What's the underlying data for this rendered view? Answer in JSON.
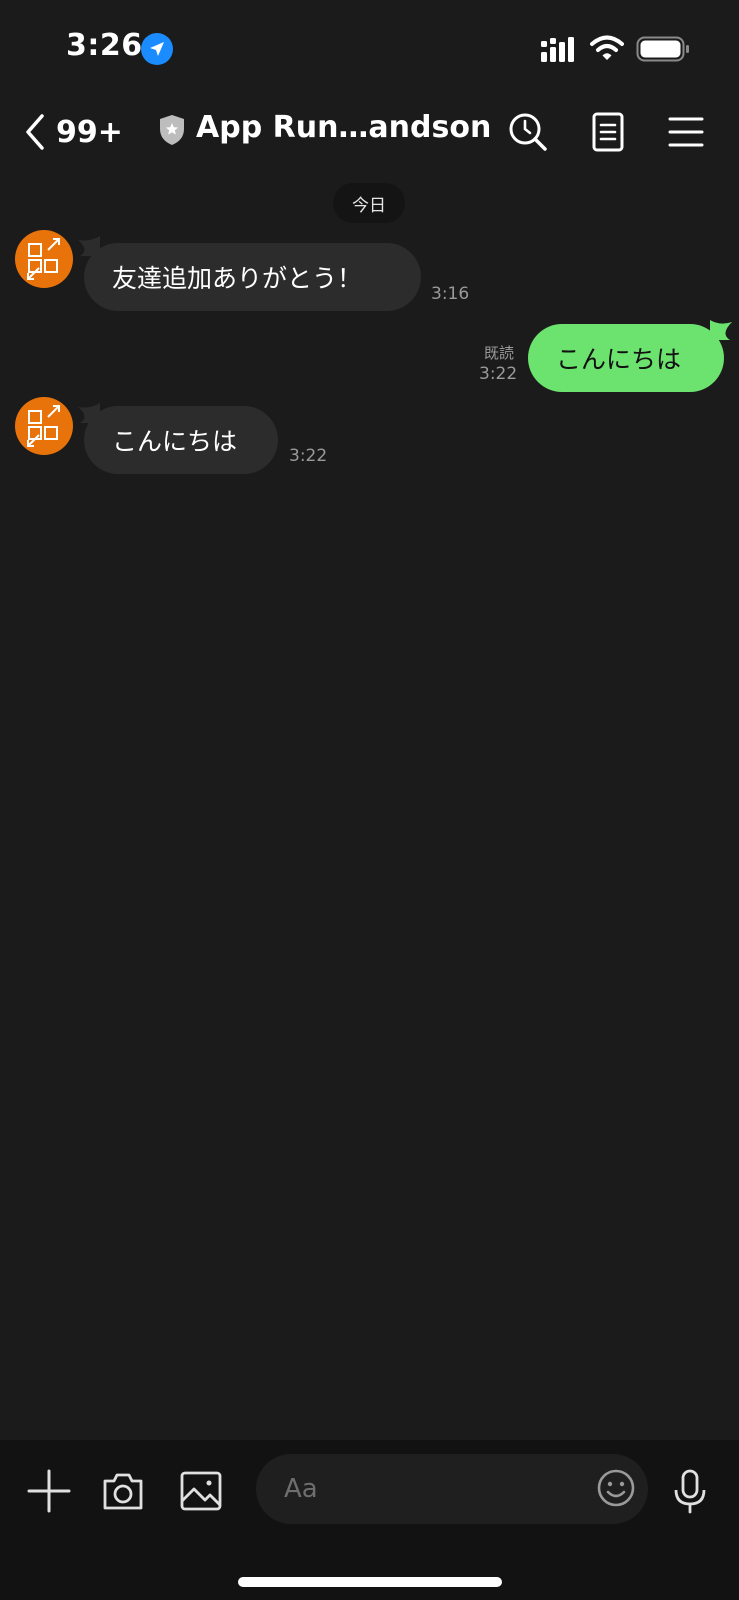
{
  "status_bar": {
    "time": "3:26",
    "icons": [
      "location-arrow-icon",
      "signal-icon",
      "wifi-icon",
      "battery-icon"
    ]
  },
  "header": {
    "back_count": "99+",
    "title": "App Run…andson",
    "icons": [
      "back-chevron-icon",
      "shield-icon",
      "search-icon",
      "notes-icon",
      "menu-icon"
    ]
  },
  "date_chip": "今日",
  "messages": [
    {
      "direction": "incoming",
      "text": "友達追加ありがとう！",
      "time": "3:16"
    },
    {
      "direction": "outgoing",
      "text": "こんにちは",
      "read": "既読",
      "time": "3:22"
    },
    {
      "direction": "incoming",
      "text": "こんにちは",
      "time": "3:22"
    }
  ],
  "composer": {
    "placeholder": "Aa",
    "value": "",
    "icons": [
      "plus-icon",
      "camera-icon",
      "image-icon",
      "emoji-icon",
      "microphone-icon"
    ]
  },
  "colors": {
    "background": "#1b1b1b",
    "incoming_bubble": "#2c2c2c",
    "outgoing_bubble": "#6de36f",
    "avatar": "#e8730a",
    "location_accent": "#1a8cff"
  }
}
